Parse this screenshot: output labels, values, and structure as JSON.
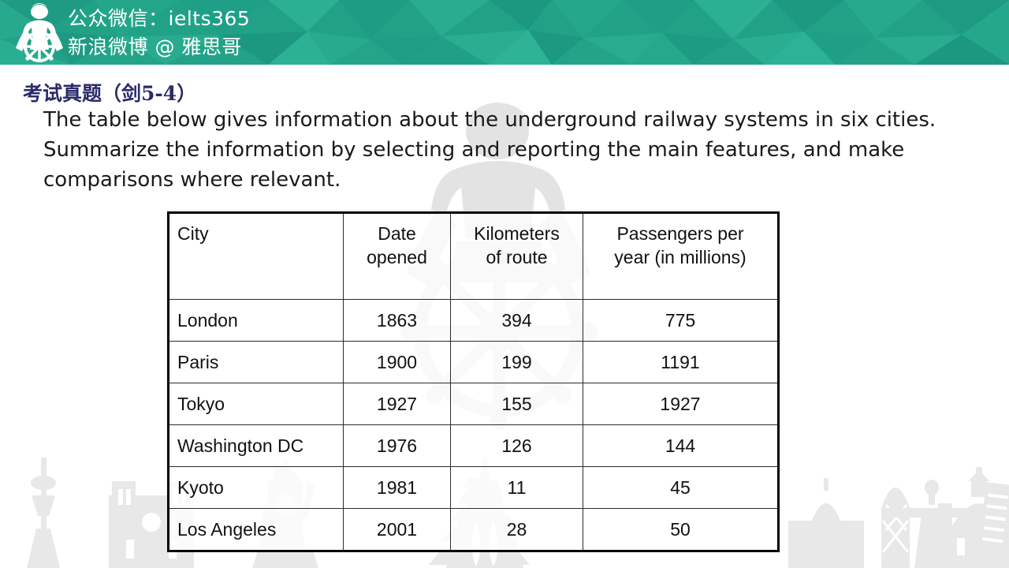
{
  "banner": {
    "logo_icon": "sailor-ships-wheel-logo",
    "background_color": "#20a186",
    "text_color": "#ffffff",
    "lines": [
      "公众微信：ielts365",
      "新浪微博 @ 雅思哥"
    ]
  },
  "section": {
    "title": "考试真题（剑5-4）",
    "title_color": "#2b2b6b"
  },
  "prompt": {
    "lines": [
      "The table below gives information about the underground railway systems in six cities.",
      "Summarize the information by selecting and reporting the main features, and make",
      "comparisons where relevant."
    ]
  },
  "chart_data": {
    "type": "table",
    "title": "Underground railway systems in six cities",
    "columns": [
      "City",
      "Date opened",
      "Kilometers of route",
      "Passengers per year (in millions)"
    ],
    "column_header_lines": [
      [
        "City"
      ],
      [
        "Date",
        "opened"
      ],
      [
        "Kilometers",
        "of route"
      ],
      [
        "Passengers per",
        "year (in millions)"
      ]
    ],
    "rows": [
      {
        "city": "London",
        "date_opened": 1863,
        "km_of_route": 394,
        "passengers_millions": 775
      },
      {
        "city": "Paris",
        "date_opened": 1900,
        "km_of_route": 199,
        "passengers_millions": 1191
      },
      {
        "city": "Tokyo",
        "date_opened": 1927,
        "km_of_route": 155,
        "passengers_millions": 1927
      },
      {
        "city": "Washington DC",
        "date_opened": 1976,
        "km_of_route": 126,
        "passengers_millions": 144
      },
      {
        "city": "Kyoto",
        "date_opened": 1981,
        "km_of_route": 11,
        "passengers_millions": 45
      },
      {
        "city": "Los Angeles",
        "date_opened": 2001,
        "km_of_route": 28,
        "passengers_millions": 50
      }
    ]
  },
  "decorations": {
    "center_watermark": "sailor-ships-wheel-watermark",
    "bottom_watermark": "world-landmarks-skyline-watermark",
    "watermark_color": "#e2e2e2"
  }
}
